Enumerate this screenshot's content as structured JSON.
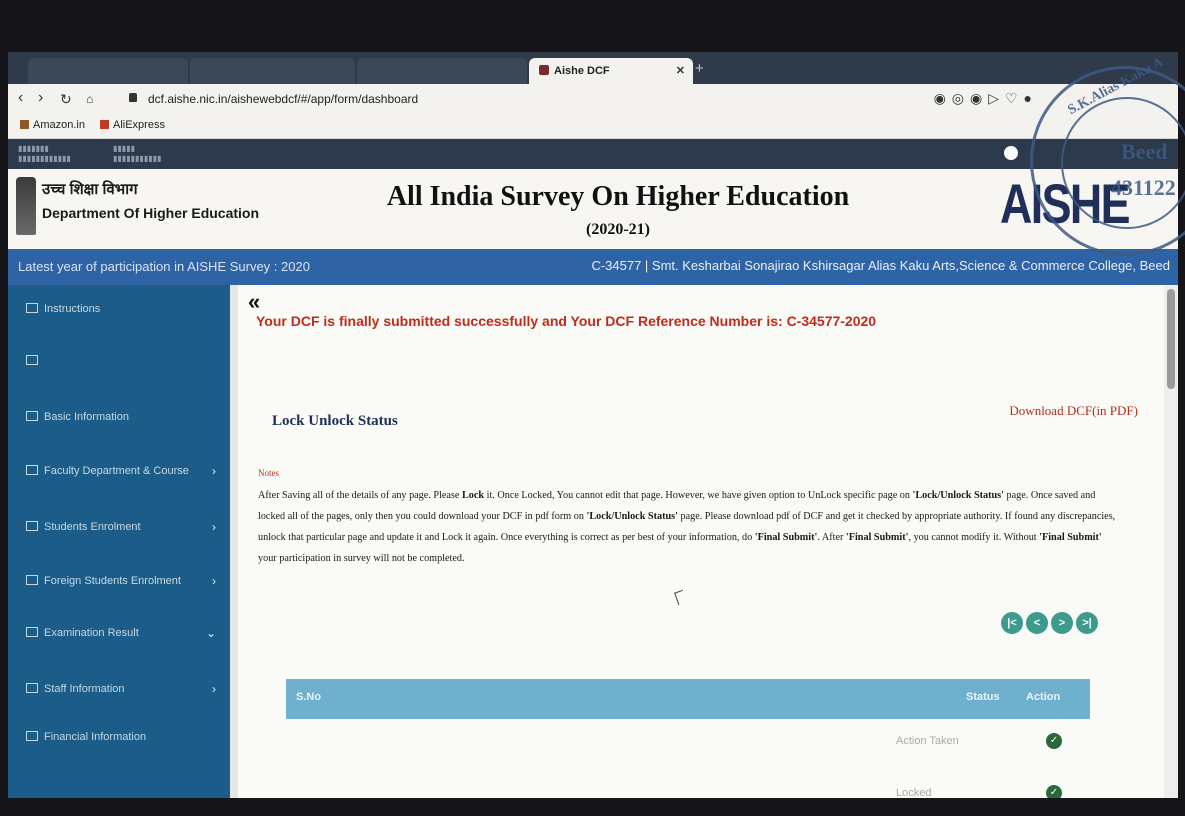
{
  "browser": {
    "tabs": [
      {
        "label": "",
        "active": false
      },
      {
        "label": "",
        "active": false
      },
      {
        "label": "",
        "active": false
      },
      {
        "label": "Aishe DCF",
        "active": true
      }
    ],
    "url": "dcf.aishe.nic.in/aishewebdcf/#/app/form/dashboard",
    "bookmarks": [
      "Amazon.in",
      "AliExpress"
    ]
  },
  "site": {
    "dept_hindi": "उच्च शिक्षा विभाग",
    "dept_english": "Department Of Higher Education",
    "title": "All India Survey On Higher Education",
    "year": "(2020-21)",
    "logo": "AISHE",
    "participation": "Latest year of participation in AISHE Survey : 2020",
    "institution": "C-34577 | Smt. Kesharbai Sonajirao Kshirsagar Alias Kaku Arts,Science & Commerce College, Beed"
  },
  "sidebar": {
    "items": [
      {
        "label": "Instructions",
        "chevron": false
      },
      {
        "label": "",
        "chevron": false
      },
      {
        "label": "Basic Information",
        "chevron": false
      },
      {
        "label": "Faculty Department & Course",
        "chevron": true
      },
      {
        "label": "Students Enrolment",
        "chevron": true
      },
      {
        "label": "Foreign Students Enrolment",
        "chevron": true
      },
      {
        "label": "Examination Result",
        "chevron": true
      },
      {
        "label": "Staff Information",
        "chevron": true
      },
      {
        "label": "Financial Information",
        "chevron": false
      }
    ]
  },
  "main": {
    "collapse_icon": "«",
    "success_message": "Your DCF is finally submitted successfully and Your DCF Reference Number is: C-34577-2020",
    "heading": "Lock Unlock Status",
    "download_link": "Download DCF(in PDF)",
    "notes_label": "Notes",
    "notes": [
      "After Saving all of the details of any page. Please ",
      "Lock",
      " it. Once Locked, You cannot edit that page. However, we have given option to UnLock specific page on ",
      "'Lock/Unlock Status'",
      " page. Once saved and locked all of the pages, only then you could download your DCF in pdf form on ",
      "'Lock/Unlock Status'",
      " page. Please download pdf of DCF and get it checked by appropriate authority. If found any discrepancies, unlock that particular page and update it and Lock it again. Once everything is correct as per best of your information, do ",
      "'Final Submit'",
      ". After ",
      "'Final Submit'",
      ", you cannot modify it. Without ",
      "'Final Submit'",
      " your participation in survey will not be completed."
    ],
    "pager": [
      "|<",
      "<",
      ">",
      ">|"
    ],
    "table": {
      "headers": [
        "S.No",
        "",
        "",
        "Status",
        "Action"
      ],
      "rows": [
        {
          "status": "Action Taken",
          "icon": "check-icon"
        },
        {
          "status": "Locked",
          "icon": "check-icon"
        }
      ]
    }
  },
  "seal": {
    "text_top": "S.K.Alias Kaku A",
    "text_right": "Beed",
    "text_number": "431122"
  },
  "colors": {
    "infobar": "#2e63a5",
    "sidebar": "#1b5c88",
    "success": "#c12b1b",
    "table_header": "#6fb0cf",
    "pager": "#3d9a8c"
  }
}
